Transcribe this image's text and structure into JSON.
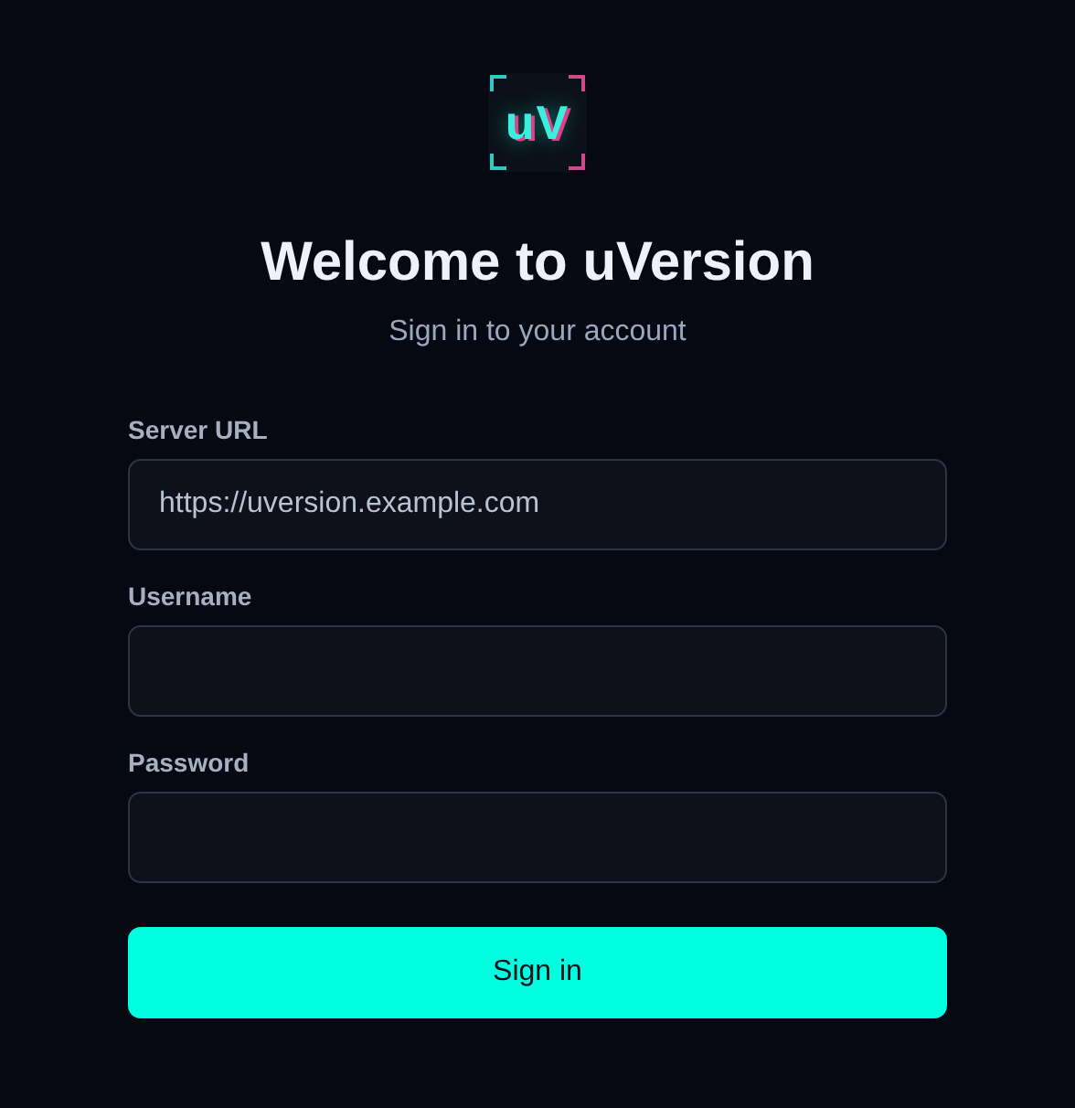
{
  "logo": {
    "text": "uV"
  },
  "title": "Welcome to uVersion",
  "subtitle": "Sign in to your account",
  "fields": [
    {
      "label": "Server URL",
      "value": "https://uversion.example.com",
      "kind": "text"
    },
    {
      "label": "Username",
      "kind": "text"
    },
    {
      "label": "Password",
      "kind": "password"
    }
  ],
  "submit": "Sign in"
}
